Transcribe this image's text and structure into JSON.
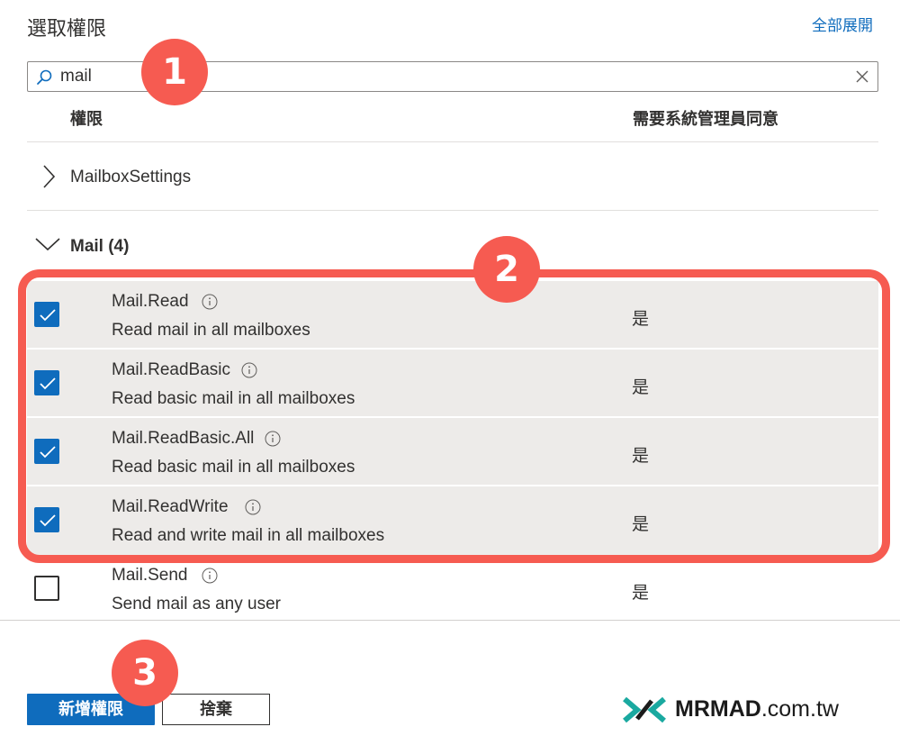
{
  "header": {
    "title": "選取權限",
    "expand_all": "全部展開"
  },
  "search": {
    "value": "mail",
    "placeholder": ""
  },
  "table": {
    "columns": {
      "permission": "權限",
      "admin_consent": "需要系統管理員同意"
    },
    "groups": [
      {
        "label": "MailboxSettings",
        "expanded": false
      },
      {
        "label": "Mail (4)",
        "expanded": true
      }
    ],
    "permissions": [
      {
        "name": "Mail.Read",
        "description": "Read mail in all mailboxes",
        "admin_consent": "是",
        "checked": true
      },
      {
        "name": "Mail.ReadBasic",
        "description": "Read basic mail in all mailboxes",
        "admin_consent": "是",
        "checked": true
      },
      {
        "name": "Mail.ReadBasic.All",
        "description": "Read basic mail in all mailboxes",
        "admin_consent": "是",
        "checked": true
      },
      {
        "name": "Mail.ReadWrite",
        "description": "Read and write mail in all mailboxes",
        "admin_consent": "是",
        "checked": true
      },
      {
        "name": "Mail.Send",
        "description": "Send mail as any user",
        "admin_consent": "是",
        "checked": false
      }
    ]
  },
  "footer": {
    "add_button": "新增權限",
    "discard_button": "捨棄"
  },
  "markers": [
    "1",
    "2",
    "3"
  ],
  "watermark": {
    "brand": "MRMAD",
    "domain": ".com.tw"
  },
  "icons": {
    "search": "search-icon",
    "clear": "close-icon",
    "collapsed": "chevron-right-icon",
    "expanded": "chevron-down-icon",
    "info": "info-icon",
    "checked": "checkmark-icon"
  },
  "colors": {
    "accent": "#0f6cbd",
    "highlight": "#f65b51",
    "selected_row": "#edebe9",
    "text": "#323130"
  }
}
